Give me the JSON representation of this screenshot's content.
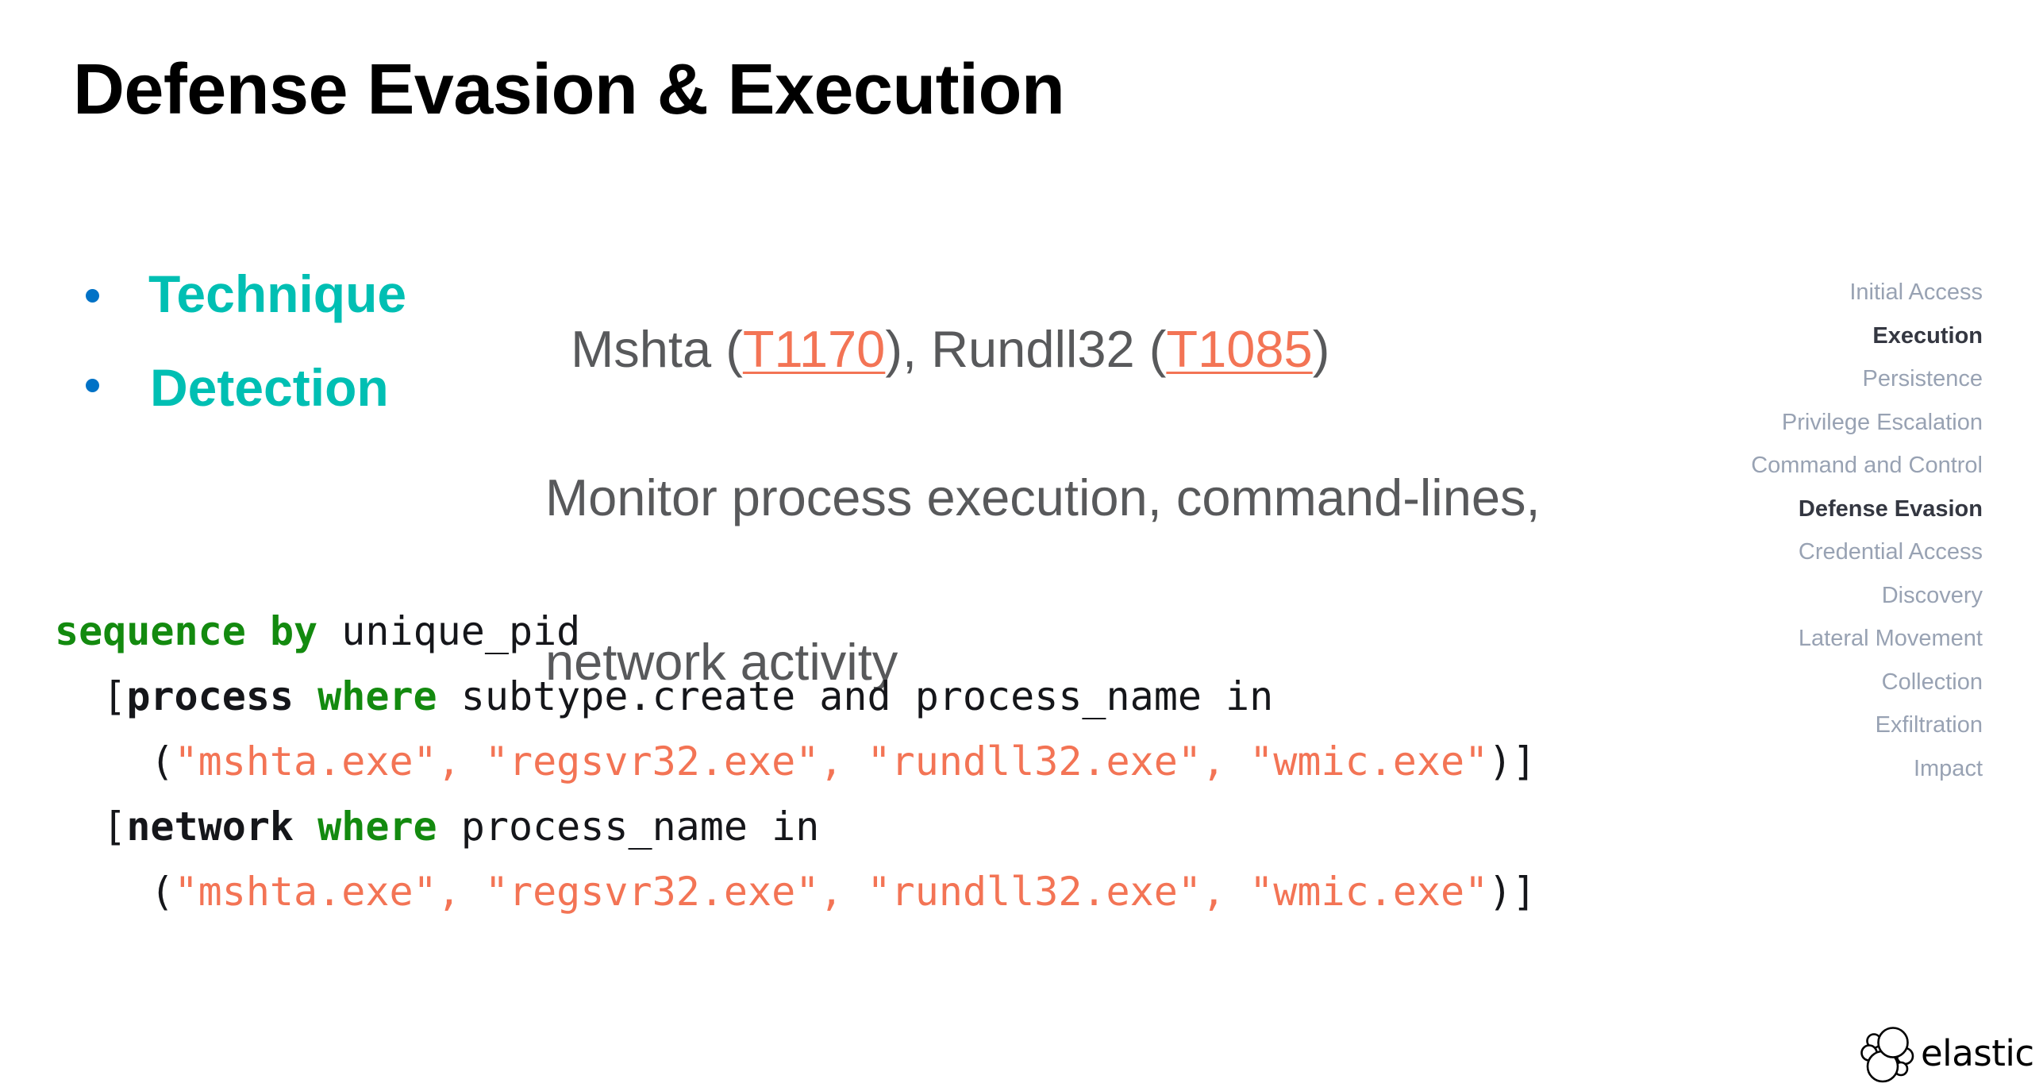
{
  "slide": {
    "title": "Defense Evasion & Execution",
    "colors": {
      "title": "#000000",
      "label": "#00BFB3",
      "bullet": "#0072C6",
      "body_text": "#58595B",
      "link": "#F37455",
      "code_keyword": "#138A0F",
      "code_string": "#F37455",
      "code_text": "#15161A",
      "nav_inactive": "#98A2B3",
      "nav_active": "#343741"
    }
  },
  "bullets": [
    {
      "label": "Technique",
      "value_parts": [
        {
          "text": "Mshta (",
          "link": false
        },
        {
          "text": "T1170",
          "link": true
        },
        {
          "text": "), Rundll32 (",
          "link": false
        },
        {
          "text": "T1085",
          "link": true
        },
        {
          "text": ")",
          "link": false
        }
      ]
    },
    {
      "label": "Detection",
      "value_lines": [
        "Monitor process execution, command-lines,",
        "network activity"
      ]
    }
  ],
  "code": {
    "lines": [
      [
        {
          "t": "sequence",
          "k": "kw"
        },
        {
          "t": " ",
          "k": "plain"
        },
        {
          "t": "by",
          "k": "kw"
        },
        {
          "t": " unique_pid",
          "k": "plain"
        }
      ],
      [
        {
          "t": "  [",
          "k": "plain"
        },
        {
          "t": "process",
          "k": "ent"
        },
        {
          "t": " ",
          "k": "plain"
        },
        {
          "t": "where",
          "k": "kw"
        },
        {
          "t": " subtype.create and process_name in",
          "k": "plain"
        }
      ],
      [
        {
          "t": "    (",
          "k": "plain"
        },
        {
          "t": "\"mshta.exe\"",
          "k": "str"
        },
        {
          "t": ", ",
          "k": "str"
        },
        {
          "t": "\"regsvr32.exe\"",
          "k": "str"
        },
        {
          "t": ", ",
          "k": "str"
        },
        {
          "t": "\"rundll32.exe\"",
          "k": "str"
        },
        {
          "t": ", ",
          "k": "str"
        },
        {
          "t": "\"wmic.exe\"",
          "k": "str"
        },
        {
          "t": ")]",
          "k": "plain"
        }
      ],
      [
        {
          "t": "  [",
          "k": "plain"
        },
        {
          "t": "network",
          "k": "ent"
        },
        {
          "t": " ",
          "k": "plain"
        },
        {
          "t": "where",
          "k": "kw"
        },
        {
          "t": " process_name in",
          "k": "plain"
        }
      ],
      [
        {
          "t": "    (",
          "k": "plain"
        },
        {
          "t": "\"mshta.exe\"",
          "k": "str"
        },
        {
          "t": ", ",
          "k": "str"
        },
        {
          "t": "\"regsvr32.exe\"",
          "k": "str"
        },
        {
          "t": ", ",
          "k": "str"
        },
        {
          "t": "\"rundll32.exe\"",
          "k": "str"
        },
        {
          "t": ", ",
          "k": "str"
        },
        {
          "t": "\"wmic.exe\"",
          "k": "str"
        },
        {
          "t": ")]",
          "k": "plain"
        }
      ]
    ]
  },
  "tactics_nav": {
    "items": [
      {
        "label": "Initial Access",
        "active": false
      },
      {
        "label": "Execution",
        "active": true
      },
      {
        "label": "Persistence",
        "active": false
      },
      {
        "label": "Privilege Escalation",
        "active": false
      },
      {
        "label": "Command and Control",
        "active": false
      },
      {
        "label": "Defense Evasion",
        "active": true
      },
      {
        "label": "Credential Access",
        "active": false
      },
      {
        "label": "Discovery",
        "active": false
      },
      {
        "label": "Lateral Movement",
        "active": false
      },
      {
        "label": "Collection",
        "active": false
      },
      {
        "label": "Exfiltration",
        "active": false
      },
      {
        "label": "Impact",
        "active": false
      }
    ]
  },
  "logo": {
    "icon": "elastic-logo-icon",
    "wordmark": "elastic"
  }
}
